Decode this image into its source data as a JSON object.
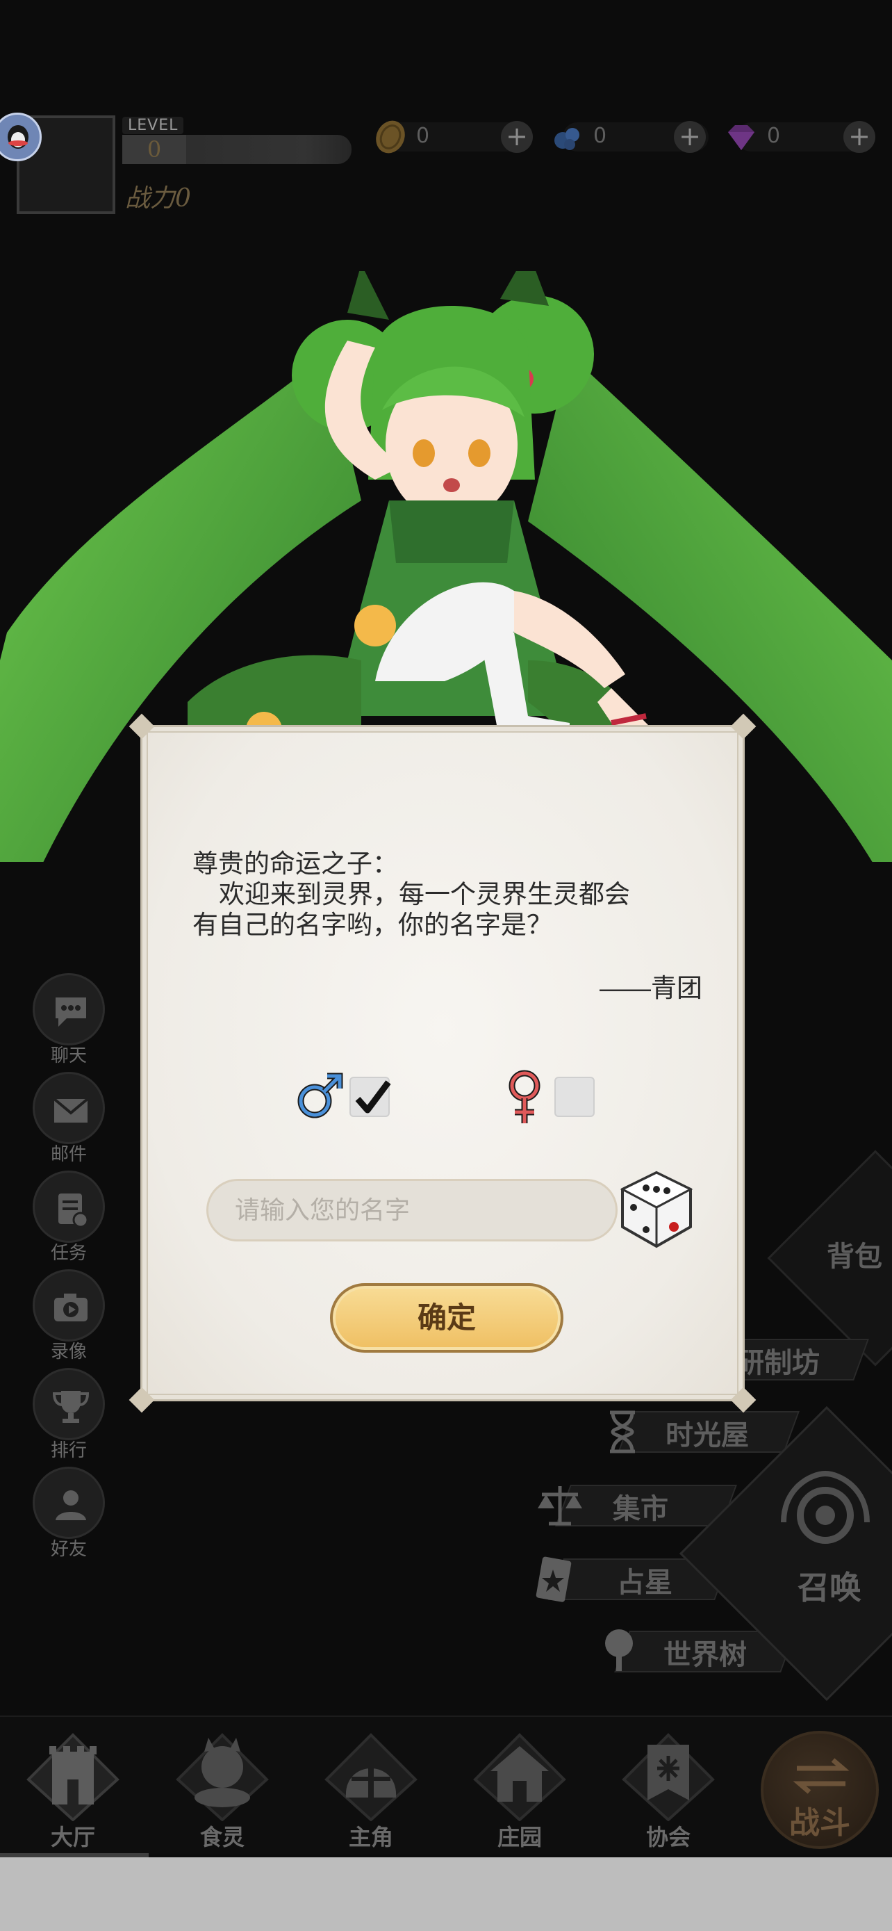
{
  "hud": {
    "level_label": "LEVEL",
    "level": "0",
    "power": "战力0",
    "resources": [
      {
        "name": "gold",
        "icon": "coin-icon",
        "value": "0"
      },
      {
        "name": "energy",
        "icon": "blue-orb-icon",
        "value": "0"
      },
      {
        "name": "gem",
        "icon": "purple-gem-icon",
        "value": "0"
      }
    ]
  },
  "left_menu": [
    "聊天",
    "邮件",
    "任务",
    "录像",
    "排行",
    "好友"
  ],
  "right_menu": {
    "bag": "背包",
    "workshop": "研制坊",
    "time_house": "时光屋",
    "market": "集市",
    "astrology": "占星",
    "world_tree": "世界树",
    "summon": "召唤"
  },
  "dialog": {
    "greeting": "尊贵的命运之子：",
    "line2": "欢迎来到灵界，每一个灵界生灵都会",
    "line3": "有自己的名字哟，你的名字是？",
    "signature": "——青团",
    "male_checked": true,
    "female_checked": false,
    "name_placeholder": "请输入您的名字",
    "name_value": "",
    "confirm": "确定"
  },
  "bottom_nav": [
    "大厅",
    "食灵",
    "主角",
    "庄园",
    "协会"
  ],
  "battle": "战斗",
  "colors": {
    "background": "#0c0c0c",
    "dialog_paper": "#f3f0ea",
    "confirm_gold": "#f3c86f",
    "male_blue": "#4a90d9",
    "female_red": "#e05a5a",
    "hair_green": "#4fae3a"
  }
}
